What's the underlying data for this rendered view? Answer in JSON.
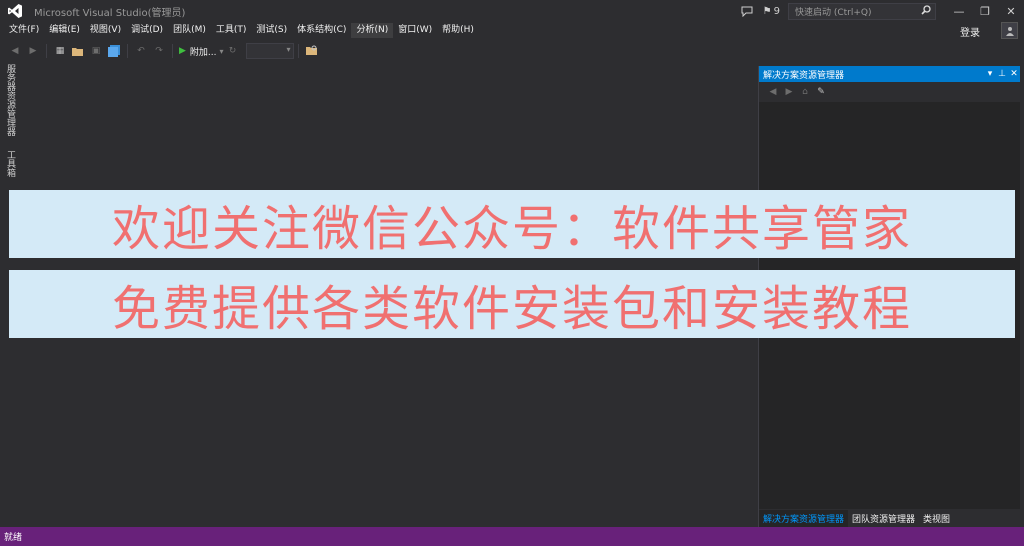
{
  "title": "Microsoft Visual Studio(管理员)",
  "notifications": {
    "count": "9"
  },
  "quick_launch": {
    "placeholder": "快速启动 (Ctrl+Q)"
  },
  "login": "登录",
  "window_buttons": {
    "minimize": "—",
    "restore": "❐",
    "close": "✕"
  },
  "menu": [
    "文件(F)",
    "编辑(E)",
    "视图(V)",
    "调试(D)",
    "团队(M)",
    "工具(T)",
    "测试(S)",
    "体系结构(C)",
    "分析(N)",
    "窗口(W)",
    "帮助(H)"
  ],
  "menu_active_index": 8,
  "toolbar": {
    "attach_label": "附加..."
  },
  "left_tabs": {
    "server_explorer": "服务器资源管理器",
    "toolbox": "工具箱"
  },
  "solution_explorer": {
    "title": "解决方案资源管理器",
    "tabs": [
      "解决方案资源管理器",
      "团队资源管理器",
      "类视图"
    ]
  },
  "banners": {
    "line1": "欢迎关注微信公众号：软件共享管家",
    "line2": "免费提供各类软件安装包和安装教程"
  },
  "status": "就绪",
  "colors": {
    "accent": "#007acc",
    "status_bar": "#68217a",
    "banner_bg": "#d4eaf7",
    "banner_text": "#f07070"
  }
}
